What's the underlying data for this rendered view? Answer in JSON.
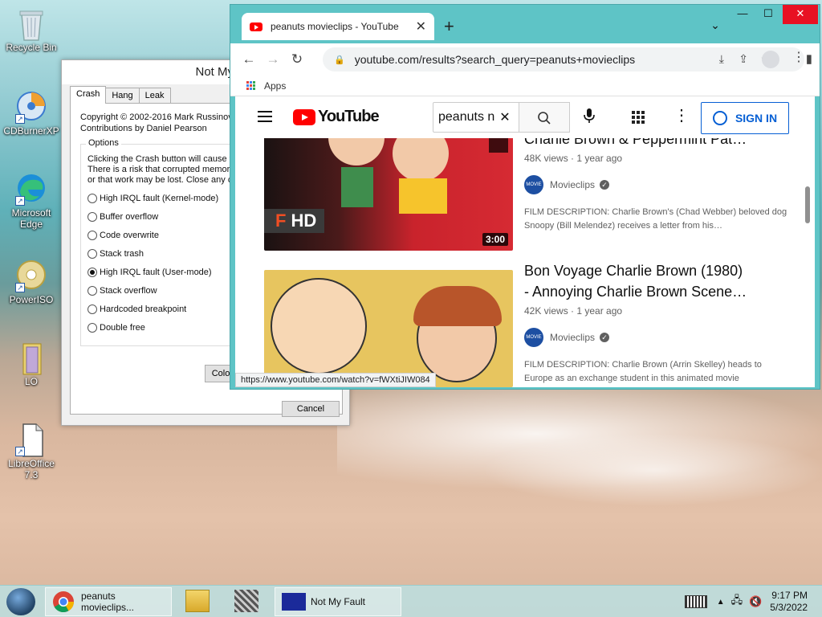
{
  "desktop": {
    "icons": [
      {
        "label": "Recycle Bin"
      },
      {
        "label": "CDBurnerXP"
      },
      {
        "label": "Microsoft Edge"
      },
      {
        "label": "PowerISO"
      },
      {
        "label": "LO"
      },
      {
        "label": "LibreOffice 7.3"
      }
    ]
  },
  "notmyfault": {
    "title": "Not My Fault",
    "tabs": [
      "Crash",
      "Hang",
      "Leak"
    ],
    "copyright": "Copyright © 2002-2016 Mark Russinov",
    "contributions": "Contributions by Daniel Pearson",
    "options_label": "Options",
    "desc_lines": [
      "Clicking the Crash button will cause t",
      "There is a risk that corrupted memor",
      "or that work may be lost. Close any c"
    ],
    "options": [
      {
        "label": "High IRQL fault (Kernel-mode)",
        "selected": false
      },
      {
        "label": "Buffer overflow",
        "selected": false
      },
      {
        "label": "Code overwrite",
        "selected": false
      },
      {
        "label": "Stack trash",
        "selected": false
      },
      {
        "label": "High IRQL fault (User-mode)",
        "selected": true
      },
      {
        "label": "Stack overflow",
        "selected": false
      },
      {
        "label": "Hardcoded breakpoint",
        "selected": false
      },
      {
        "label": "Double free",
        "selected": false
      }
    ],
    "crash_button_partial": "Colo",
    "cancel_button": "Cancel"
  },
  "chrome": {
    "tab_title": "peanuts movieclips - YouTube",
    "url": "youtube.com/results?search_query=peanuts+movieclips",
    "bookmarks_apps": "Apps",
    "status_url": "https://www.youtube.com/watch?v=fWXtiJIW084"
  },
  "youtube": {
    "logo_text": "YouTube",
    "search_value": "peanuts n",
    "sign_in": "SIGN IN",
    "results": [
      {
        "title": "Charlie Brown & Peppermint Pat…",
        "meta": "48K views · 1 year ago",
        "channel": "Movieclips",
        "description": "FILM DESCRIPTION: Charlie Brown's (Chad Webber) beloved dog Snoopy (Bill Melendez) receives a letter from his…",
        "duration": "3:00",
        "badge": "HD"
      },
      {
        "title_line1": "Bon Voyage Charlie Brown (1980)",
        "title_line2": "- Annoying Charlie Brown Scene…",
        "meta": "42K views · 1 year ago",
        "channel": "Movieclips",
        "description": "FILM DESCRIPTION: Charlie Brown (Arrin Skelley) heads to",
        "description2": "Europe as an exchange student in this animated movie"
      }
    ]
  },
  "taskbar": {
    "items": [
      {
        "label": "peanuts movieclips..."
      },
      {
        "label": "Not My Fault"
      }
    ],
    "time": "9:17 PM",
    "date": "5/3/2022"
  }
}
